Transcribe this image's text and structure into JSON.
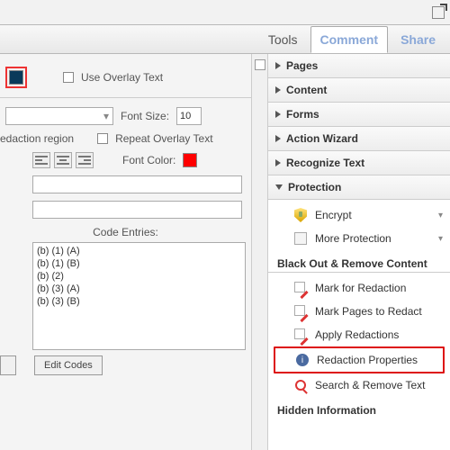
{
  "tabs": {
    "tools": "Tools",
    "comment": "Comment",
    "share": "Share"
  },
  "dialog": {
    "use_overlay": "Use Overlay Text",
    "font_size_label": "Font Size:",
    "font_size_value": "10",
    "redaction_region": "edaction region",
    "repeat_overlay": "Repeat Overlay Text",
    "font_color": "Font Color:",
    "code_entries": "Code Entries:",
    "edit_codes": "Edit Codes",
    "codes": [
      "(b) (1) (A)",
      "(b) (1) (B)",
      "(b) (2)",
      "(b) (3) (A)",
      "(b) (3) (B)",
      "",
      ""
    ]
  },
  "sections": {
    "pages": "Pages",
    "content": "Content",
    "forms": "Forms",
    "action_wizard": "Action Wizard",
    "recognize_text": "Recognize Text",
    "protection": "Protection",
    "hidden_info": "Hidden Information"
  },
  "protection": {
    "encrypt": "Encrypt",
    "more_protection": "More Protection",
    "subhead": "Black Out & Remove Content",
    "mark_for_redaction": "Mark for Redaction",
    "mark_pages": "Mark Pages to Redact",
    "apply_redactions": "Apply Redactions",
    "redaction_props": "Redaction Properties",
    "search_remove": "Search & Remove Text"
  }
}
